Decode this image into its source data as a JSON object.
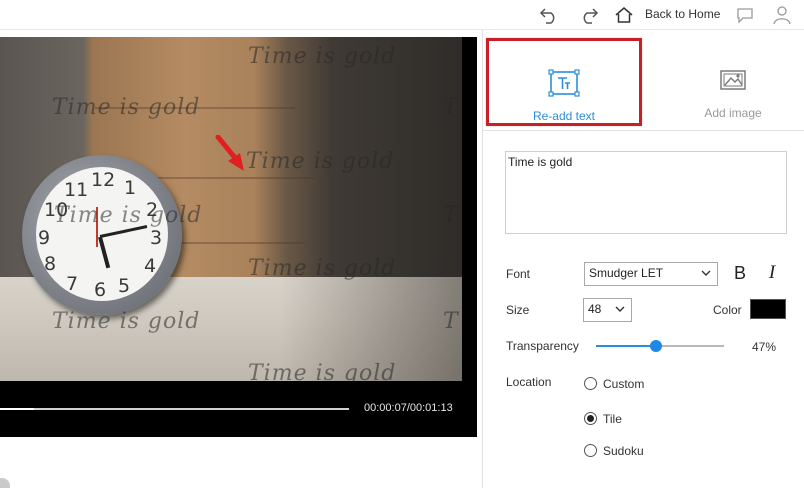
{
  "topbar": {
    "undo_icon": "undo-icon",
    "redo_icon": "redo-icon",
    "home_icon": "home-icon",
    "home_label": "Back to Home",
    "chat_icon": "chat-bubble-icon",
    "user_icon": "user-icon"
  },
  "player": {
    "watermark_text": "Time is gold",
    "time": "00:00:07/00:01:13",
    "progress": 0.096
  },
  "tabs": {
    "readd_label": "Re-add text",
    "addimage_label": "Add image"
  },
  "editor": {
    "text_value": "Time is gold",
    "font_label": "Font",
    "font_value": "Smudger LET",
    "bold": "B",
    "italic": "I",
    "size_label": "Size",
    "size_value": "48",
    "color_label": "Color",
    "color_value": "#000000",
    "transparency_label": "Transparency",
    "transparency_value": "47%",
    "transparency_fraction": 0.47,
    "location_label": "Location",
    "location_options": [
      "Custom",
      "Tile",
      "Sudoku"
    ],
    "location_selected": "Tile"
  },
  "colors": {
    "accent": "#2b8fd8",
    "highlight_box": "#c72026",
    "arrow": "#e02020"
  }
}
